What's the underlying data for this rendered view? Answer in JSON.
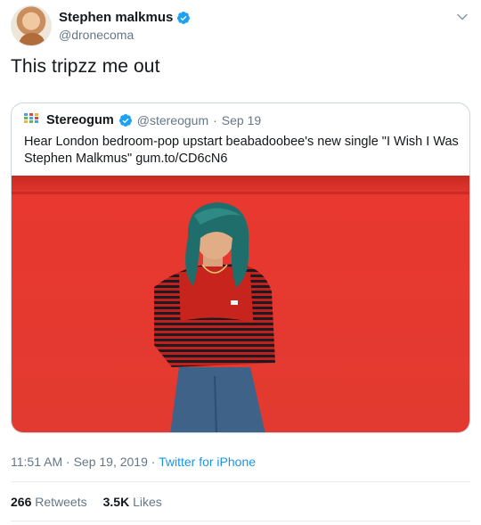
{
  "author": {
    "display_name": "Stephen malkmus",
    "handle": "@dronecoma",
    "avatar_icon": "profile-photo",
    "verified": true
  },
  "tweet": {
    "text": "This tripzz me out"
  },
  "quoted_tweet": {
    "display_name": "Stereogum",
    "handle": "@stereogum",
    "separator": "·",
    "date": "Sep 19",
    "text": "Hear London bedroom-pop upstart beabadoobee's new single \"I Wish I Was Stephen Malkmus\" gum.to/CD6cN6",
    "verified": true,
    "logo_icon": "stereogum-logo"
  },
  "meta": {
    "time": "11:51 AM",
    "separator": "·",
    "date": "Sep 19, 2019",
    "source": "Twitter for iPhone"
  },
  "stats": {
    "retweets_count": "266",
    "retweets_label": "Retweets",
    "likes_count": "3.5K",
    "likes_label": "Likes"
  },
  "colors": {
    "link": "#1b95e0",
    "verified": "#1da1f2",
    "secondary_text": "#657786",
    "photo_background": "#e8382f"
  }
}
